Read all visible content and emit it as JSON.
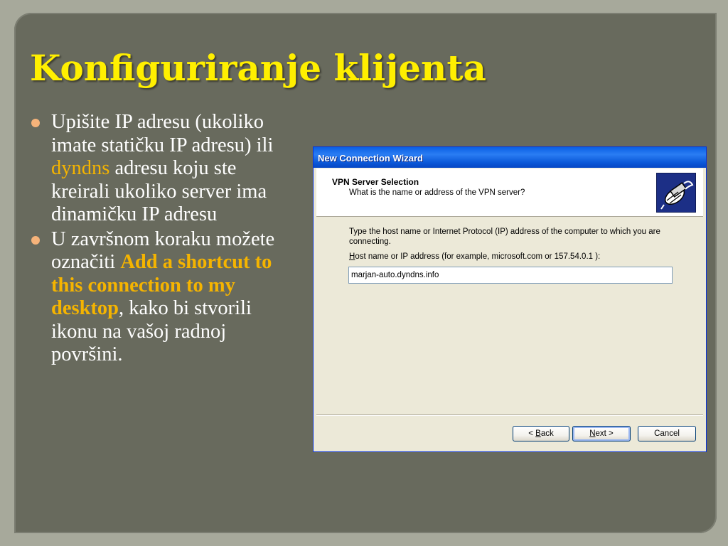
{
  "slide": {
    "title": "Konfiguriranje klijenta",
    "bullets": [
      {
        "before": "Upišite IP adresu (ukoliko imate statičku IP adresu) ili ",
        "highlight": "dyndns",
        "after": " adresu koju ste kreirali  ukoliko server ima dinamičku IP adresu"
      },
      {
        "before": "U završnom koraku možete označiti ",
        "highlight": "Add a shortcut to this connection to my desktop",
        "after": ", kako bi stvorili ikonu na vašoj radnoj površini."
      }
    ]
  },
  "dialog": {
    "title": "New Connection Wizard",
    "header_title": "VPN Server Selection",
    "header_subtitle": "What is the name or address of the VPN server?",
    "icon": "vpn-wizard-icon",
    "description": "Type the host name or Internet Protocol (IP) address of the computer to which you are connecting.",
    "field_label_accel": "H",
    "field_label_rest": "ost name or IP address (for example, microsoft.com or 157.54.0.1 ):",
    "host_value": "marjan-auto.dyndns.info",
    "buttons": {
      "back_prefix": "< ",
      "back_accel": "B",
      "back_rest": "ack",
      "next_accel": "N",
      "next_rest": "ext >",
      "cancel": "Cancel"
    }
  },
  "colors": {
    "title": "#ffef00",
    "highlight": "#f5b400",
    "slide_bg": "#686a5d",
    "xp_titlebar": "#0a5fe4"
  }
}
